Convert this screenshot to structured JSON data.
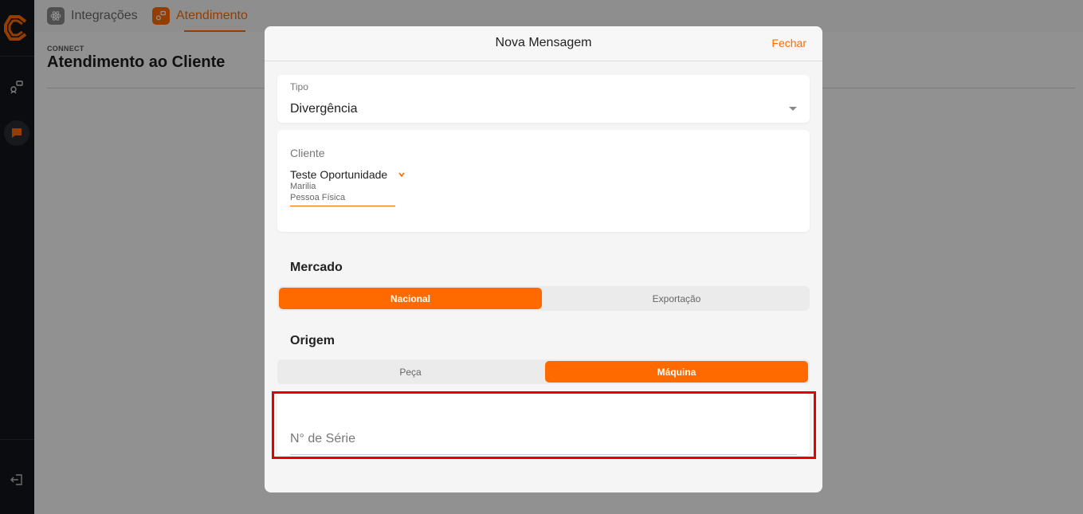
{
  "sidebar": {
    "icons": [
      "logo-icon",
      "integrations-icon",
      "chat-icon",
      "logout-icon"
    ]
  },
  "topbar": {
    "tabs": [
      {
        "label": "Integrações",
        "icon": "atom-icon"
      },
      {
        "label": "Atendimento",
        "icon": "support-icon"
      }
    ]
  },
  "page": {
    "eyebrow": "CONNECT",
    "title": "Atendimento ao Cliente"
  },
  "modal": {
    "title": "Nova Mensagem",
    "close_label": "Fechar",
    "tipo": {
      "label": "Tipo",
      "value": "Divergência"
    },
    "cliente": {
      "label": "Cliente",
      "name": "Teste Oportunidade",
      "city": "Marilia",
      "type": "Pessoa Física"
    },
    "mercado": {
      "title": "Mercado",
      "options": [
        "Nacional",
        "Exportação"
      ],
      "selected": "Nacional"
    },
    "origem": {
      "title": "Origem",
      "options": [
        "Peça",
        "Máquina"
      ],
      "selected": "Máquina"
    },
    "serie": {
      "label": "N° de Série",
      "value": ""
    }
  },
  "colors": {
    "accent": "#ff6a00",
    "sidebar_bg": "#14151a",
    "highlight": "#e60000"
  }
}
